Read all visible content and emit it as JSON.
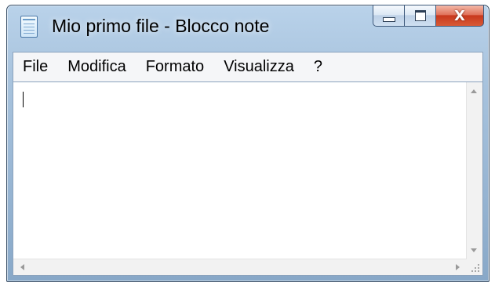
{
  "window": {
    "title": "Mio primo file - Blocco note",
    "app_icon": "notepad-icon",
    "caption_buttons": {
      "minimize_icon": "minimize-icon",
      "maximize_icon": "maximize-icon",
      "close_glyph": "X"
    },
    "accent_colors": {
      "frame": "#a9c4de",
      "close_button": "#c8381c"
    }
  },
  "menubar": {
    "items": [
      {
        "label": "File"
      },
      {
        "label": "Modifica"
      },
      {
        "label": "Formato"
      },
      {
        "label": "Visualizza"
      },
      {
        "label": "?"
      }
    ]
  },
  "editor": {
    "text": ""
  },
  "scrollbars": {
    "vertical_icons": [
      "arrow-up-icon",
      "arrow-down-icon"
    ],
    "horizontal_icons": [
      "arrow-left-icon",
      "arrow-right-icon"
    ]
  }
}
